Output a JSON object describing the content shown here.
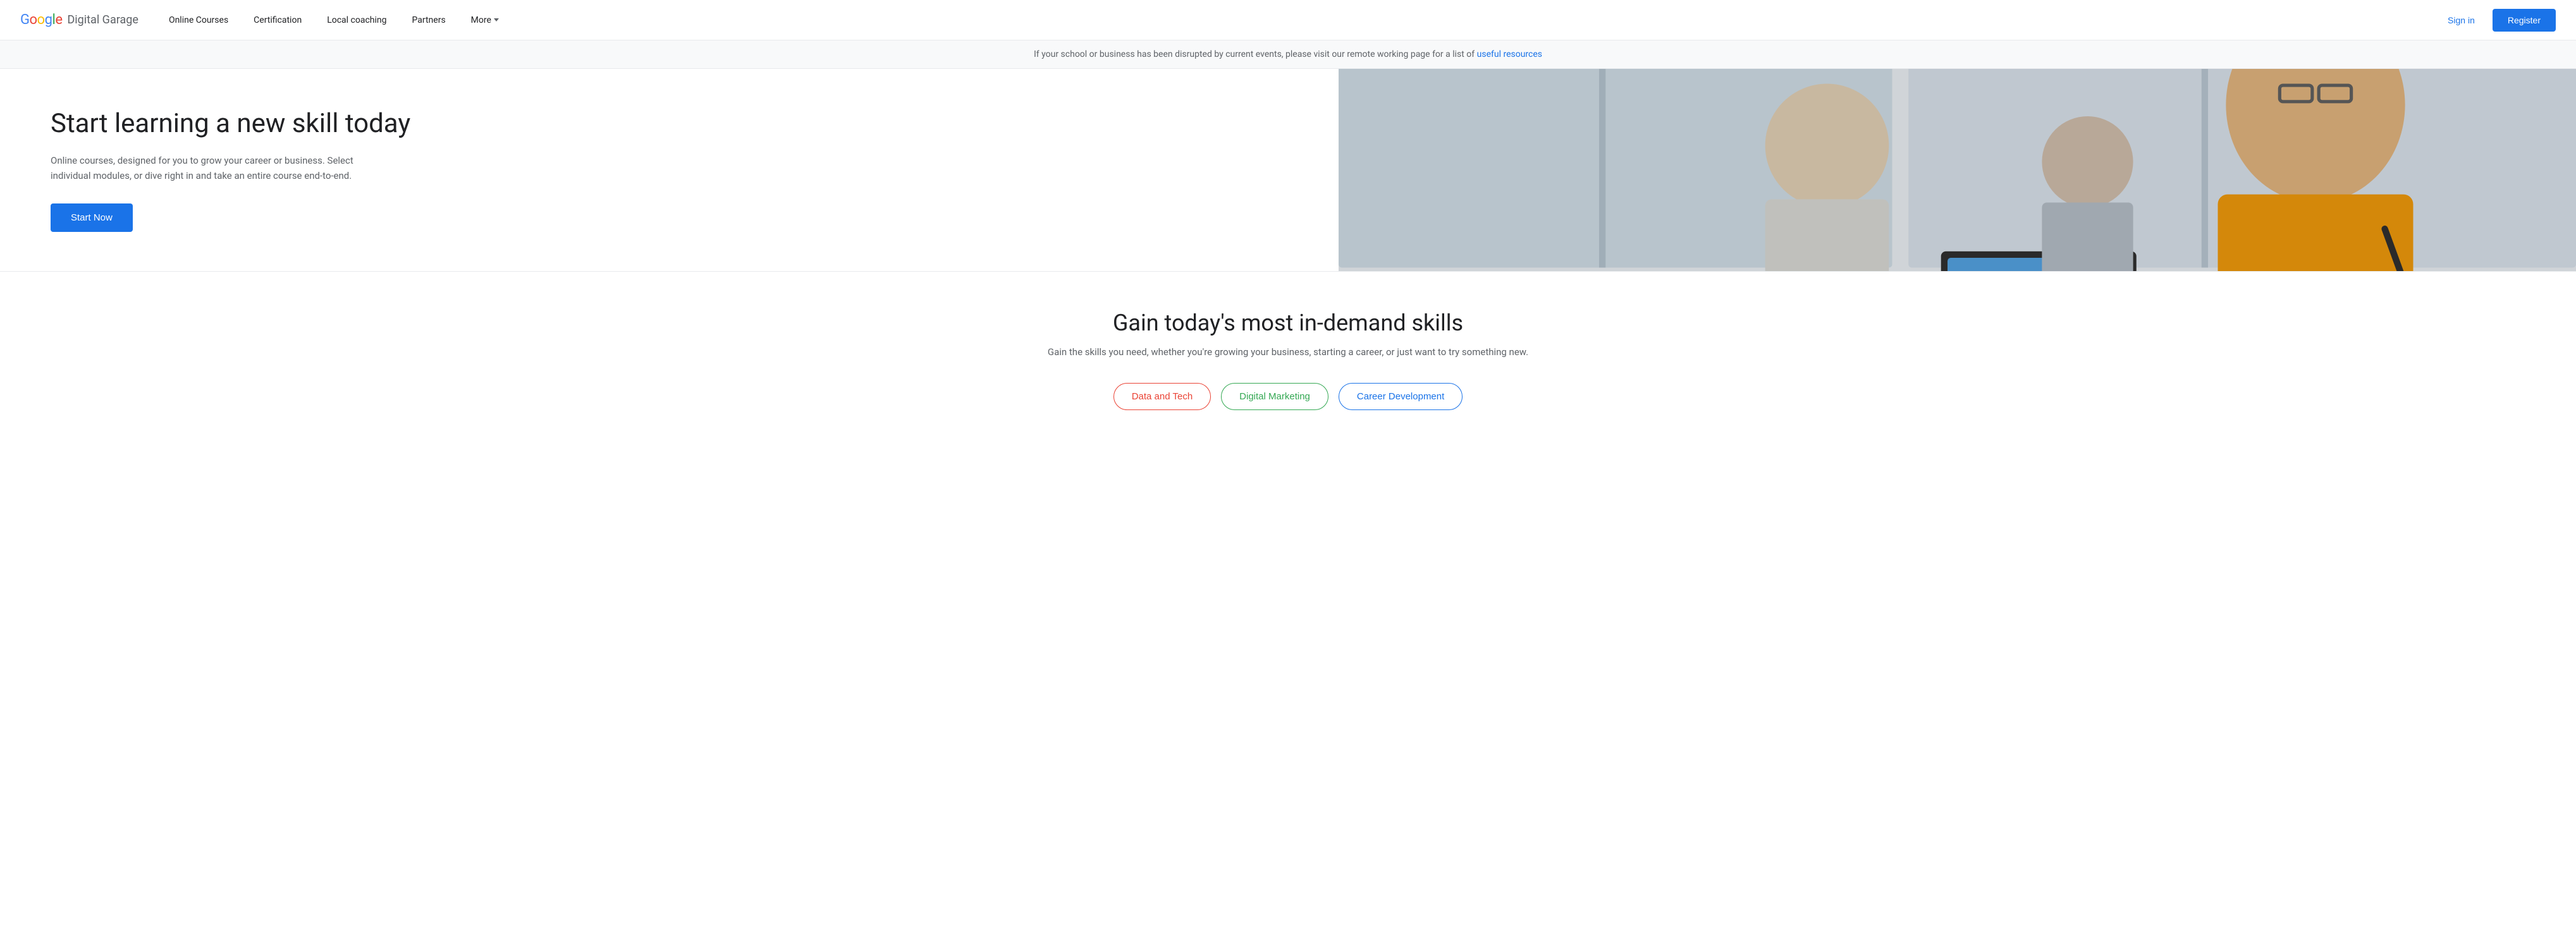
{
  "navbar": {
    "logo": {
      "google_text": "Google",
      "brand_text": "Digital Garage"
    },
    "nav_items": [
      {
        "label": "Online Courses",
        "id": "online-courses"
      },
      {
        "label": "Certification",
        "id": "certification"
      },
      {
        "label": "Local coaching",
        "id": "local-coaching"
      },
      {
        "label": "Partners",
        "id": "partners"
      },
      {
        "label": "More",
        "id": "more",
        "has_dropdown": true
      }
    ],
    "sign_in_label": "Sign in",
    "register_label": "Register"
  },
  "alert_banner": {
    "text": "If your school or business has been disrupted by current events, please visit our remote working page for a list of ",
    "link_text": "useful resources",
    "link_url": "#"
  },
  "hero": {
    "title": "Start learning a new skill today",
    "description": "Online courses, designed for you to grow your career or business. Select individual modules, or dive right in and take an entire course end-to-end.",
    "cta_label": "Start Now"
  },
  "skills_section": {
    "title": "Gain today's most in-demand skills",
    "description": "Gain the skills you need, whether you're growing your business, starting a career, or just want to try something new.",
    "tabs": [
      {
        "label": "Data and Tech",
        "color_class": "data-tech",
        "id": "data-tech"
      },
      {
        "label": "Digital Marketing",
        "color_class": "digital-marketing",
        "id": "digital-marketing"
      },
      {
        "label": "Career Development",
        "color_class": "career-dev",
        "id": "career-dev"
      }
    ]
  }
}
